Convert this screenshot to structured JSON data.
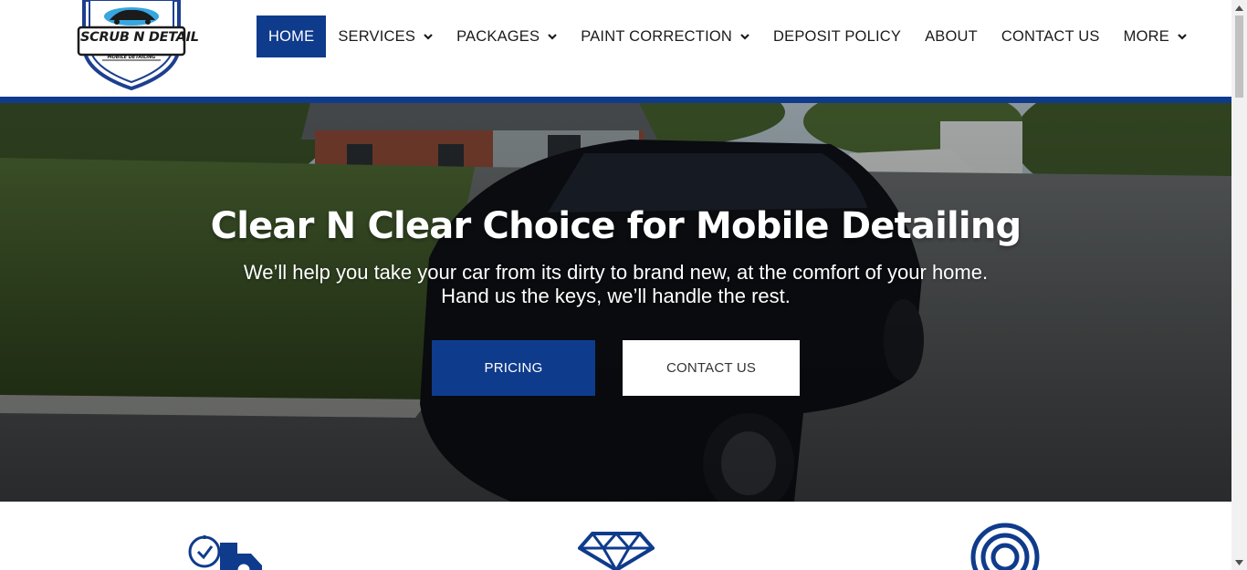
{
  "logo": {
    "main_text": "SCRUB N DETAIL",
    "sub_text": "MOBILE DETAILING"
  },
  "nav": {
    "items": [
      {
        "label": "HOME",
        "has_dropdown": false,
        "active": true
      },
      {
        "label": "SERVICES",
        "has_dropdown": true,
        "active": false
      },
      {
        "label": "PACKAGES",
        "has_dropdown": true,
        "active": false
      },
      {
        "label": "PAINT CORRECTION",
        "has_dropdown": true,
        "active": false
      },
      {
        "label": "DEPOSIT POLICY",
        "has_dropdown": false,
        "active": false
      },
      {
        "label": "ABOUT",
        "has_dropdown": false,
        "active": false
      },
      {
        "label": "CONTACT US",
        "has_dropdown": false,
        "active": false
      },
      {
        "label": "MORE",
        "has_dropdown": true,
        "active": false
      }
    ]
  },
  "hero": {
    "title": "Clear N Clear Choice for Mobile Detailing",
    "subtitle_line1": "We’ll help you take your car from its dirty to brand new, at the comfort of your home.",
    "subtitle_line2": "Hand us the keys, we’ll handle the rest.",
    "pricing_button": "PRICING",
    "contact_button": "CONTACT US"
  },
  "features": {
    "icons": [
      "on-time-delivery-icon",
      "diamond-icon",
      "spiral-icon"
    ]
  },
  "colors": {
    "brand_blue": "#0f3b8c",
    "nav_text": "#1b1b1b",
    "white": "#ffffff"
  }
}
